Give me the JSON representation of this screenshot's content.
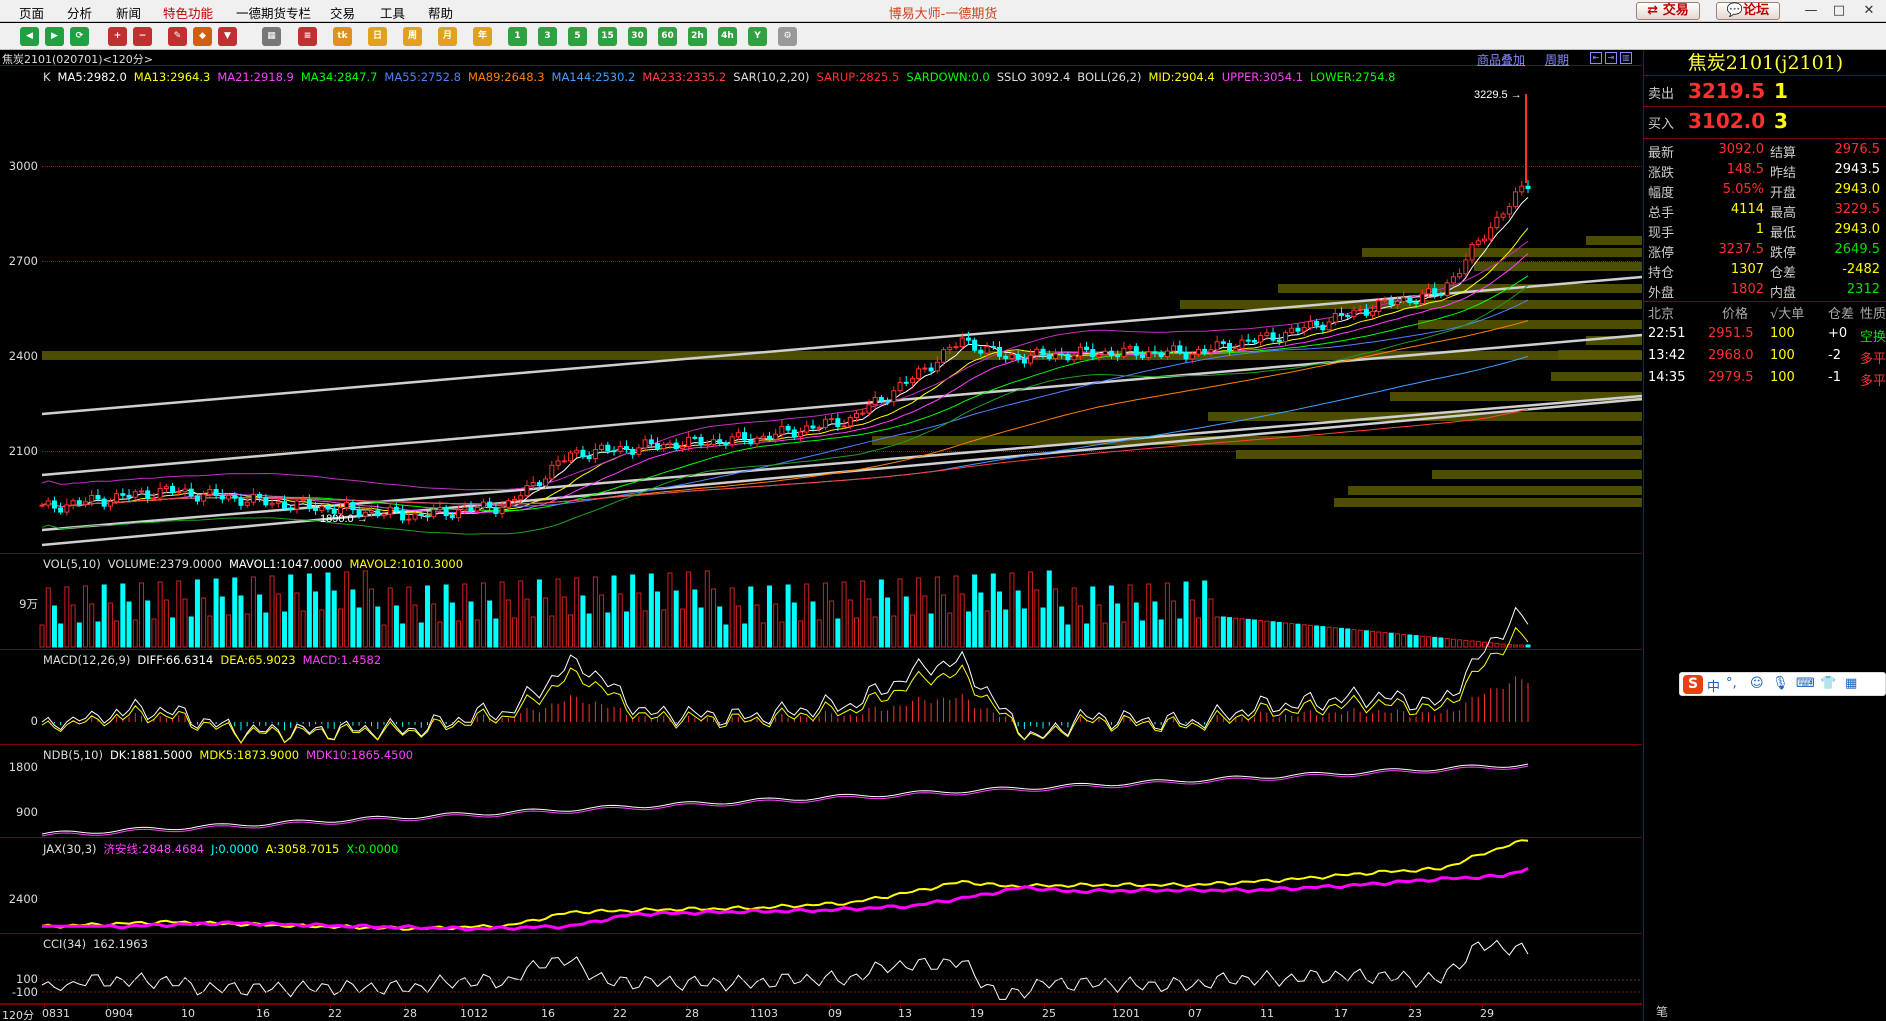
{
  "window": {
    "title": "博易大师-一德期货",
    "trade_button": "交易",
    "forum_button": "论坛",
    "minimize": "—",
    "restore": "□",
    "close": "✕"
  },
  "menu": [
    "页面",
    "分析",
    "新闻",
    "特色功能",
    "一德期货专栏",
    "交易",
    "工具",
    "帮助"
  ],
  "toolbar_icons": [
    {
      "name": "back-icon",
      "color": "#20a040",
      "glyph": "◀"
    },
    {
      "name": "forward-icon",
      "color": "#20a040",
      "glyph": "▶"
    },
    {
      "name": "refresh-icon",
      "color": "#20a040",
      "glyph": "⟳"
    },
    {
      "name": "zoom-in-icon",
      "color": "#c03030",
      "glyph": "+"
    },
    {
      "name": "zoom-out-icon",
      "color": "#c03030",
      "glyph": "−"
    },
    {
      "name": "pen-icon",
      "color": "#c03030",
      "glyph": "✎"
    },
    {
      "name": "eraser-icon",
      "color": "#d06010",
      "glyph": "◆"
    },
    {
      "name": "filter-icon",
      "color": "#c03030",
      "glyph": "▼"
    },
    {
      "name": "table-icon",
      "color": "#777",
      "glyph": "▦"
    },
    {
      "name": "list-icon",
      "color": "#c03030",
      "glyph": "≡"
    },
    {
      "name": "tick-icon",
      "color": "#e09020",
      "glyph": "tk"
    },
    {
      "name": "day-icon",
      "color": "#e0a020",
      "glyph": "日"
    },
    {
      "name": "week-icon",
      "color": "#e0a020",
      "glyph": "周"
    },
    {
      "name": "month-icon",
      "color": "#e0a020",
      "glyph": "月"
    },
    {
      "name": "year-icon",
      "color": "#e0a020",
      "glyph": "年"
    },
    {
      "name": "period-1-icon",
      "color": "#30a040",
      "glyph": "1"
    },
    {
      "name": "period-3-icon",
      "color": "#30a040",
      "glyph": "3"
    },
    {
      "name": "period-5-icon",
      "color": "#30a040",
      "glyph": "5"
    },
    {
      "name": "period-15-icon",
      "color": "#30a040",
      "glyph": "15"
    },
    {
      "name": "period-30-icon",
      "color": "#30a040",
      "glyph": "30"
    },
    {
      "name": "period-60-icon",
      "color": "#30a040",
      "glyph": "60"
    },
    {
      "name": "period-2h-icon",
      "color": "#30a040",
      "glyph": "2h"
    },
    {
      "name": "period-4h-icon",
      "color": "#30a040",
      "glyph": "4h"
    },
    {
      "name": "period-y-icon",
      "color": "#30a040",
      "glyph": "Y"
    },
    {
      "name": "settings-icon",
      "color": "#999",
      "glyph": "⚙"
    }
  ],
  "chart_header": {
    "contract": "焦炭2101(020701)<120分>",
    "overlay_link": "商品叠加",
    "period_link": "周期"
  },
  "kline_legend": [
    {
      "text": "K",
      "color": "#dddddd"
    },
    {
      "text": "MA5:2982.0",
      "color": "#ffffff"
    },
    {
      "text": "MA13:2964.3",
      "color": "#ffff00"
    },
    {
      "text": "MA21:2918.9",
      "color": "#ff40ff"
    },
    {
      "text": "MA34:2847.7",
      "color": "#00ff00"
    },
    {
      "text": "MA55:2752.8",
      "color": "#5080ff"
    },
    {
      "text": "MA89:2648.3",
      "color": "#ff8000"
    },
    {
      "text": "MA144:2530.2",
      "color": "#40a0ff"
    },
    {
      "text": "MA233:2335.2",
      "color": "#ff4040"
    },
    {
      "text": "SAR(10,2,20)",
      "color": "#dddddd"
    },
    {
      "text": "SARUP:2825.5",
      "color": "#ff3030"
    },
    {
      "text": "SARDOWN:0.0",
      "color": "#00ff00"
    },
    {
      "text": "SSLO 3092.4",
      "color": "#dddddd"
    },
    {
      "text": "BOLL(26,2)",
      "color": "#dddddd"
    },
    {
      "text": "MID:2904.4",
      "color": "#ffff00"
    },
    {
      "text": "UPPER:3054.1",
      "color": "#ff40ff"
    },
    {
      "text": "LOWER:2754.8",
      "color": "#00ff00"
    }
  ],
  "kline_labels": {
    "high_marker": "3229.5",
    "low_marker": "1890.0"
  },
  "vol_legend": [
    {
      "text": "VOL(5,10)",
      "color": "#dddddd"
    },
    {
      "text": "VOLUME:2379.0000",
      "color": "#dddddd"
    },
    {
      "text": "MAVOL1:1047.0000",
      "color": "#ffffff"
    },
    {
      "text": "MAVOL2:1010.3000",
      "color": "#ffff00"
    }
  ],
  "macd_legend": [
    {
      "text": "MACD(12,26,9)",
      "color": "#dddddd"
    },
    {
      "text": "DIFF:66.6314",
      "color": "#ffffff"
    },
    {
      "text": "DEA:65.9023",
      "color": "#ffff00"
    },
    {
      "text": "MACD:1.4582",
      "color": "#ff40ff"
    }
  ],
  "ndb_legend": [
    {
      "text": "NDB(5,10)",
      "color": "#dddddd"
    },
    {
      "text": "DK:1881.5000",
      "color": "#ffffff"
    },
    {
      "text": "MDK5:1873.9000",
      "color": "#ffff00"
    },
    {
      "text": "MDK10:1865.4500",
      "color": "#ff40ff"
    }
  ],
  "jax_legend": [
    {
      "text": "JAX(30,3)",
      "color": "#dddddd"
    },
    {
      "text": "济安线:2848.4684",
      "color": "#ff40ff"
    },
    {
      "text": "J:0.0000",
      "color": "#00ffff"
    },
    {
      "text": "A:3058.7015",
      "color": "#ffff00"
    },
    {
      "text": "X:0.0000",
      "color": "#00ff00"
    }
  ],
  "cci_legend": [
    {
      "text": "CCI(34)",
      "color": "#dddddd"
    },
    {
      "text": "162.1963",
      "color": "#dddddd"
    }
  ],
  "axes": {
    "price": [
      "3000",
      "2700",
      "2400",
      "2100"
    ],
    "vol": [
      "9万"
    ],
    "macd": [
      "0"
    ],
    "ndb": [
      "1800",
      "900"
    ],
    "jax": [
      "2400"
    ],
    "cci": [
      "100",
      "-100"
    ]
  },
  "xaxis": {
    "period": "120分",
    "ticks": [
      "0831",
      "0904",
      "10",
      "16",
      "22",
      "28",
      "1012",
      "16",
      "22",
      "28",
      "1103",
      "09",
      "13",
      "19",
      "25",
      "1201",
      "07",
      "11",
      "17",
      "23",
      "29"
    ]
  },
  "quote": {
    "title": "焦炭2101(j2101)",
    "ask": {
      "label": "卖出",
      "price": "3219.5",
      "qty": "1"
    },
    "bid": {
      "label": "买入",
      "price": "3102.0",
      "qty": "3"
    },
    "rows": [
      {
        "k1": "最新",
        "v1": "3092.0",
        "c1": "r",
        "k2": "结算",
        "v2": "2976.5",
        "c2": "r"
      },
      {
        "k1": "涨跌",
        "v1": "148.5",
        "c1": "r",
        "k2": "昨结",
        "v2": "2943.5",
        "c2": "w"
      },
      {
        "k1": "幅度",
        "v1": "5.05%",
        "c1": "r",
        "k2": "开盘",
        "v2": "2943.0",
        "c2": "y"
      },
      {
        "k1": "总手",
        "v1": "4114",
        "c1": "y",
        "k2": "最高",
        "v2": "3229.5",
        "c2": "r"
      },
      {
        "k1": "现手",
        "v1": "1",
        "c1": "y",
        "k2": "最低",
        "v2": "2943.0",
        "c2": "y"
      },
      {
        "k1": "涨停",
        "v1": "3237.5",
        "c1": "r",
        "k2": "跌停",
        "v2": "2649.5",
        "c2": "g"
      },
      {
        "k1": "持仓",
        "v1": "1307",
        "c1": "y",
        "k2": "仓差",
        "v2": "-2482",
        "c2": "y"
      },
      {
        "k1": "外盘",
        "v1": "1802",
        "c1": "r",
        "k2": "内盘",
        "v2": "2312",
        "c2": "g"
      }
    ],
    "ticks_header": [
      "北京",
      "价格",
      "√大单",
      "仓差",
      "性质"
    ],
    "ticks": [
      {
        "time": "22:51",
        "price": "2951.5",
        "vol": "100",
        "oi": "+0",
        "nature": "空换"
      },
      {
        "time": "13:42",
        "price": "2968.0",
        "vol": "100",
        "oi": "-2",
        "nature": "多平"
      },
      {
        "time": "14:35",
        "price": "2979.5",
        "vol": "100",
        "oi": "-1",
        "nature": "多平"
      }
    ],
    "footer": "笔"
  },
  "ime": {
    "mode": "中",
    "punct": "°,",
    "emoji": "☺",
    "mic": "🎙",
    "keyboard": "⌨",
    "skin": "👕",
    "tools": "▦"
  }
}
